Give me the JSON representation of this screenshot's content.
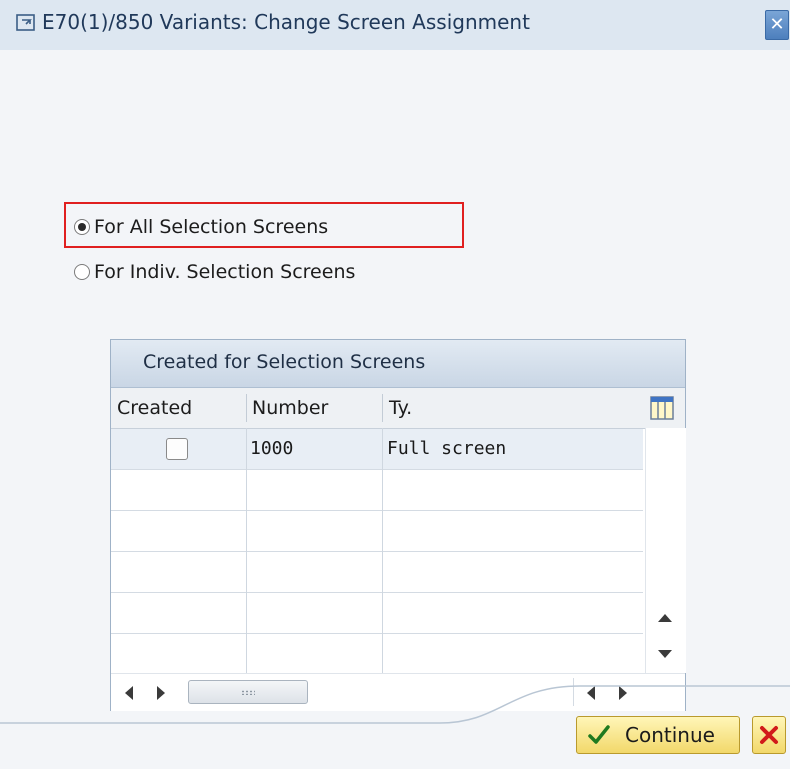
{
  "window": {
    "title": "E70(1)/850 Variants: Change Screen Assignment",
    "close_glyph": "✕"
  },
  "options": {
    "all_screens": {
      "label": "For All Selection Screens",
      "selected": true
    },
    "indiv_screens": {
      "label": "For Indiv. Selection Screens",
      "selected": false
    }
  },
  "table": {
    "title": "Created for Selection Screens",
    "columns": [
      "Created",
      "Number",
      "Ty."
    ],
    "rows": [
      {
        "created": false,
        "number": "1000",
        "type": "Full screen"
      }
    ]
  },
  "footer": {
    "continue_label": "Continue"
  },
  "colors": {
    "highlight": "#e02020",
    "title_bar": "#dde7f1",
    "button_yellow": "#f2d86a"
  },
  "icons": {
    "window": "maximize-icon",
    "close": "close-icon",
    "table_settings": "table-settings-icon",
    "continue": "checkmark-icon",
    "cancel": "cancel-icon"
  }
}
